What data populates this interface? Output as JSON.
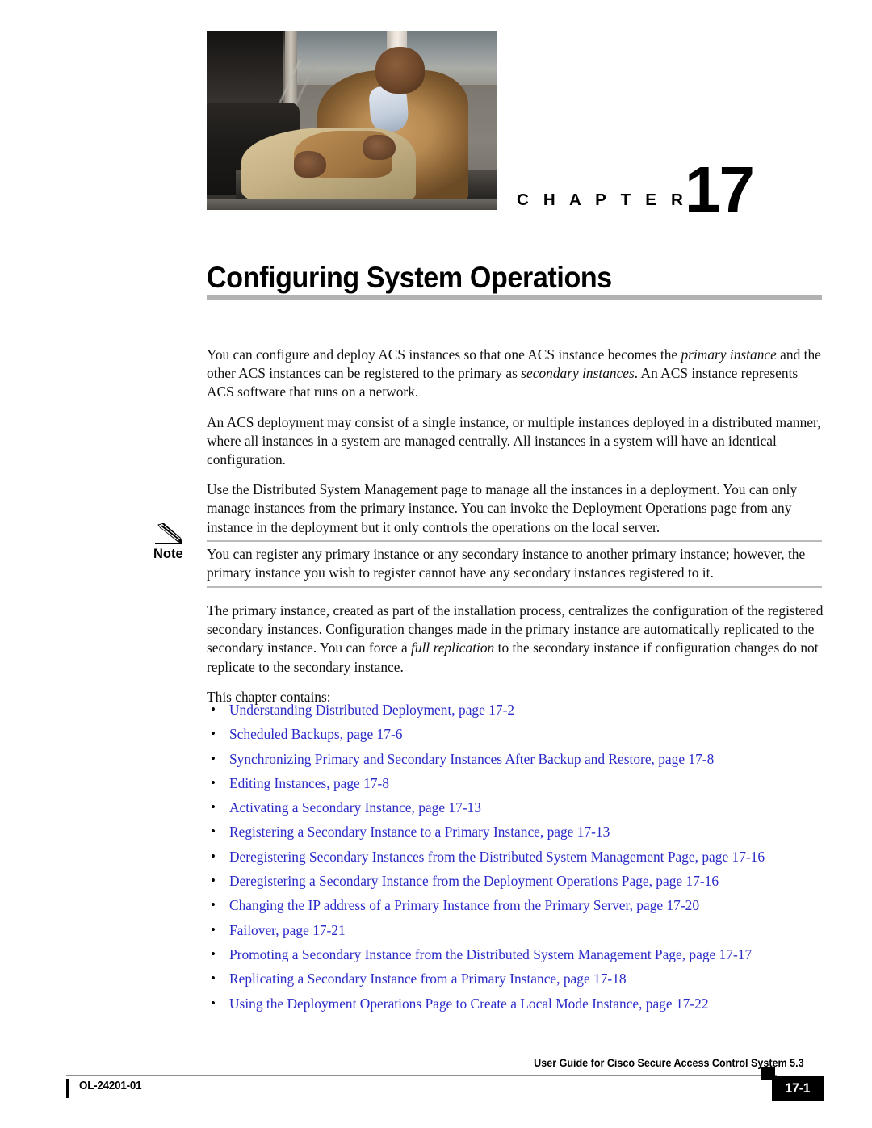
{
  "chapter": {
    "label": "C H A P T E R",
    "number": "17",
    "title": "Configuring System Operations",
    "photo_alt": "chapter-opener-photo"
  },
  "intro": {
    "p1_a": "You can configure and deploy ACS instances so that one ACS instance becomes the ",
    "p1_i1": "primary instance",
    "p1_b": " and the other ACS instances can be registered to the primary as ",
    "p1_i2": "secondary instances",
    "p1_c": ". An ACS instance represents ACS software that runs on a network.",
    "p2": "An ACS deployment may consist of a single instance, or multiple instances deployed in a distributed manner, where all instances in a system are managed centrally. All instances in a system will have an identical configuration.",
    "p3": "Use the Distributed System Management page to manage all the instances in a deployment. You can only manage instances from the primary instance. You can invoke the Deployment Operations page from any instance in the deployment but it only controls the operations on the local server."
  },
  "note": {
    "label": "Note",
    "icon": "pencil-icon",
    "text": "You can register any primary instance or any secondary instance to another primary instance; however, the primary instance you wish to register cannot have any secondary instances registered to it."
  },
  "body": {
    "p4_a": "The primary instance, created as part of the installation process, centralizes the configuration of the registered secondary instances. Configuration changes made in the primary instance are automatically replicated to the secondary instance. You can force a ",
    "p4_i": "full replication",
    "p4_b": " to the secondary instance if configuration changes do not replicate to the secondary instance.",
    "p5": "This chapter contains:"
  },
  "toc": {
    "link_color": "#2a2ac8",
    "items": [
      "Understanding Distributed Deployment, page 17-2",
      "Scheduled Backups, page 17-6",
      "Synchronizing Primary and Secondary Instances After Backup and Restore, page 17-8",
      "Editing Instances, page 17-8",
      "Activating a Secondary Instance, page 17-13",
      "Registering a Secondary Instance to a Primary Instance, page 17-13",
      "Deregistering Secondary Instances from the Distributed System Management Page, page 17-16",
      "Deregistering a Secondary Instance from the Deployment Operations Page, page 17-16",
      "Changing the IP address of a Primary Instance from the Primary Server, page 17-20",
      "Failover, page 17-21",
      "Promoting a Secondary Instance from the Distributed System Management Page, page 17-17",
      "Replicating a Secondary Instance from a Primary Instance, page 17-18",
      "Using the Deployment Operations Page to Create a Local Mode Instance, page 17-22"
    ]
  },
  "footer": {
    "guide_title": "User Guide for Cisco Secure Access Control System 5.3",
    "doc_id": "OL-24201-01",
    "page_number": "17-1"
  }
}
